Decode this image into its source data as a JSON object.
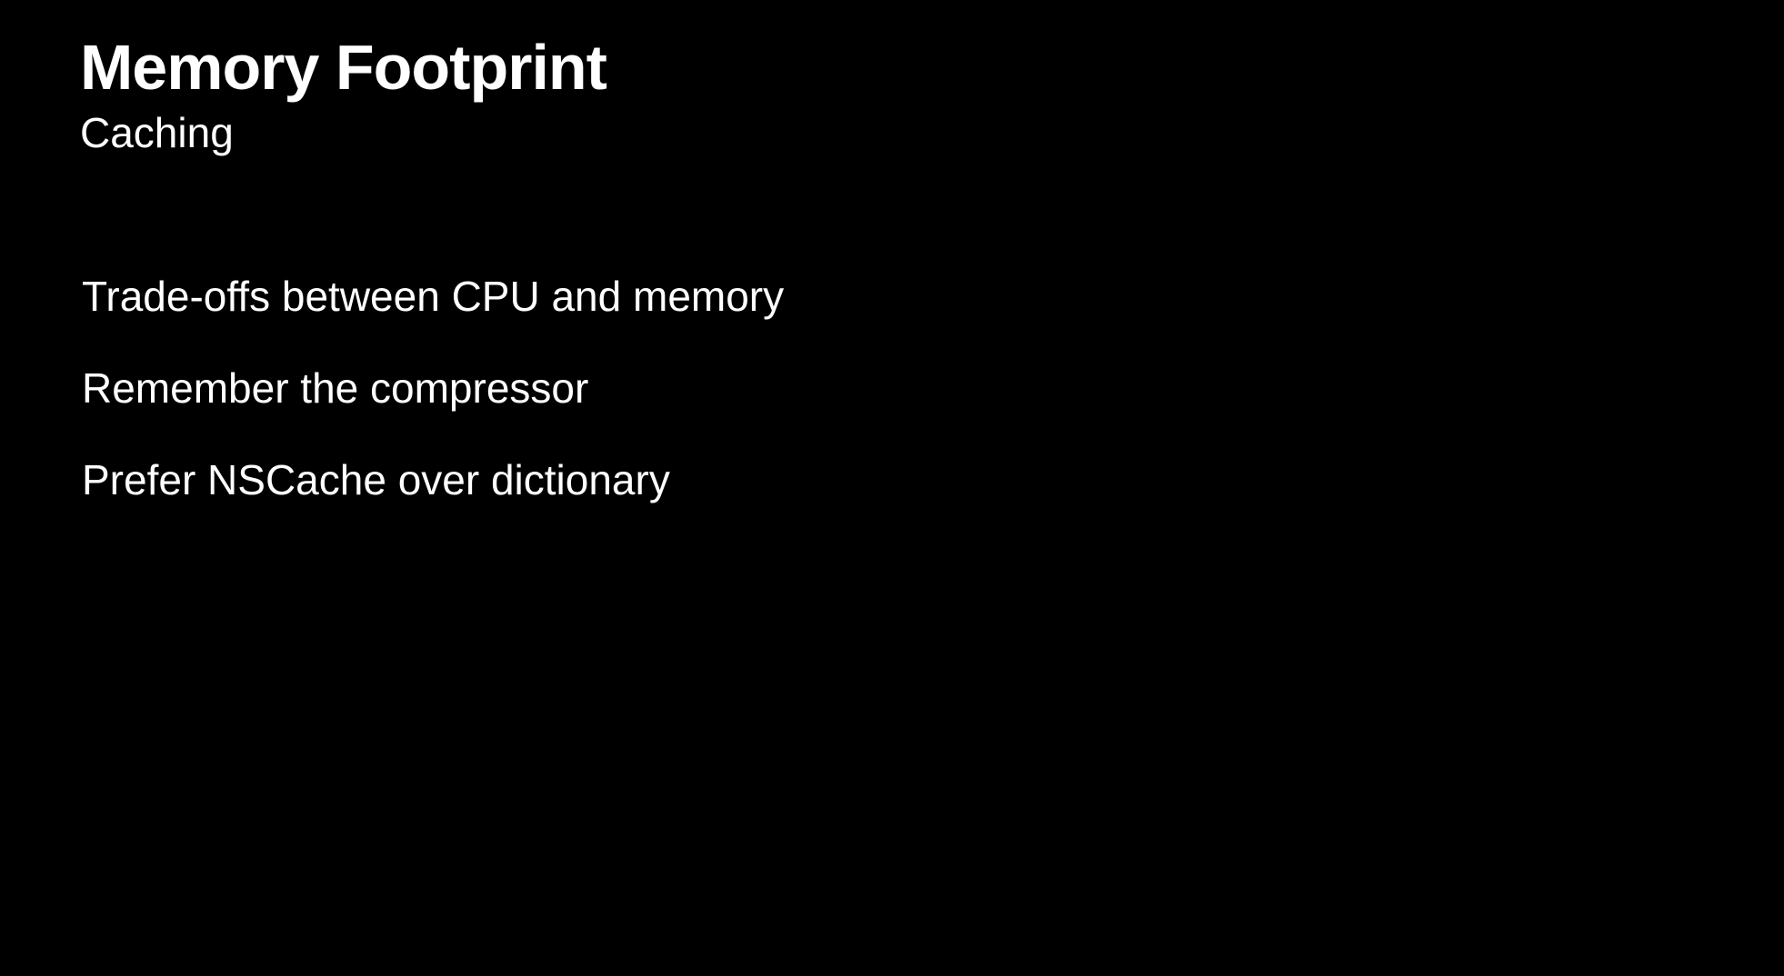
{
  "slide": {
    "title": "Memory Footprint",
    "subtitle": "Caching",
    "bullets": [
      "Trade-offs between CPU and memory",
      "Remember the compressor",
      "Prefer NSCache over dictionary"
    ]
  }
}
